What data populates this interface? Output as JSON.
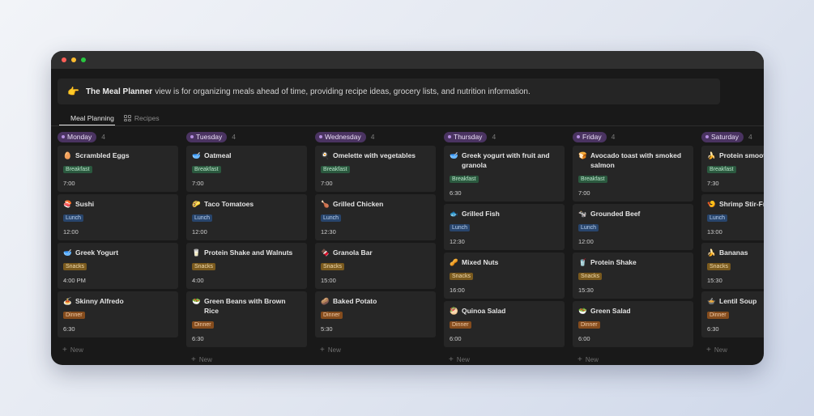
{
  "callout": {
    "emoji": "👉",
    "bold": "The Meal Planner",
    "text": "view is for organizing meals ahead of time, providing recipe ideas, grocery lists, and nutrition information."
  },
  "tabs": [
    {
      "label": "Meal Planning",
      "icon": "board-icon",
      "active": true
    },
    {
      "label": "Recipes",
      "icon": "gallery-icon",
      "active": false
    }
  ],
  "new_label": "New",
  "colors": {
    "Breakfast": "#2b593f",
    "Lunch": "#28456c",
    "Snacks": "#7a5a1e",
    "Dinner": "#854c1d",
    "day_pill": "#4a3361"
  },
  "columns": [
    {
      "day": "Monday",
      "count": "4",
      "cards": [
        {
          "emoji": "🥚",
          "title": "Scrambled Eggs",
          "tag": "Breakfast",
          "time": "7:00"
        },
        {
          "emoji": "🍣",
          "title": "Sushi",
          "tag": "Lunch",
          "time": "12:00"
        },
        {
          "emoji": "🥣",
          "title": "Greek Yogurt",
          "tag": "Snacks",
          "time": "4:00 PM"
        },
        {
          "emoji": "🍝",
          "title": "Skinny Alfredo",
          "tag": "Dinner",
          "time": "6:30"
        }
      ]
    },
    {
      "day": "Tuesday",
      "count": "4",
      "cards": [
        {
          "emoji": "🥣",
          "title": "Oatmeal",
          "tag": "Breakfast",
          "time": "7:00"
        },
        {
          "emoji": "🌮",
          "title": "Taco Tomatoes",
          "tag": "Lunch",
          "time": "12:00"
        },
        {
          "emoji": "🥛",
          "title": "Protein Shake and Walnuts",
          "tag": "Snacks",
          "time": "4:00"
        },
        {
          "emoji": "🥗",
          "title": "Green Beans with Brown Rice",
          "tag": "Dinner",
          "time": "6:30"
        }
      ]
    },
    {
      "day": "Wednesday",
      "count": "4",
      "cards": [
        {
          "emoji": "🍳",
          "title": "Omelette with vegetables",
          "tag": "Breakfast",
          "time": "7:00"
        },
        {
          "emoji": "🍗",
          "title": "Grilled Chicken",
          "tag": "Lunch",
          "time": "12:30"
        },
        {
          "emoji": "🍫",
          "title": "Granola Bar",
          "tag": "Snacks",
          "time": "15:00"
        },
        {
          "emoji": "🥔",
          "title": "Baked Potato",
          "tag": "Dinner",
          "time": "5:30"
        }
      ]
    },
    {
      "day": "Thursday",
      "count": "4",
      "cards": [
        {
          "emoji": "🥣",
          "title": "Greek yogurt with fruit and granola",
          "tag": "Breakfast",
          "time": "6:30"
        },
        {
          "emoji": "🐟",
          "title": "Grilled Fish",
          "tag": "Lunch",
          "time": "12:30"
        },
        {
          "emoji": "🥜",
          "title": "Mixed Nuts",
          "tag": "Snacks",
          "time": "16:00"
        },
        {
          "emoji": "🥙",
          "title": "Quinoa Salad",
          "tag": "Dinner",
          "time": "6:00"
        }
      ]
    },
    {
      "day": "Friday",
      "count": "4",
      "cards": [
        {
          "emoji": "🍞",
          "title": "Avocado toast with smoked salmon",
          "tag": "Breakfast",
          "time": "7:00"
        },
        {
          "emoji": "🐄",
          "title": "Grounded Beef",
          "tag": "Lunch",
          "time": "12:00"
        },
        {
          "emoji": "🥤",
          "title": "Protein Shake",
          "tag": "Snacks",
          "time": "15:30"
        },
        {
          "emoji": "🥗",
          "title": "Green Salad",
          "tag": "Dinner",
          "time": "6:00"
        }
      ]
    },
    {
      "day": "Saturday",
      "count": "4",
      "cards": [
        {
          "emoji": "🍌",
          "title": "Protein smoothie",
          "tag": "Breakfast",
          "time": "7:30"
        },
        {
          "emoji": "🍤",
          "title": "Shrimp Stir-Fry",
          "tag": "Lunch",
          "time": "13:00"
        },
        {
          "emoji": "🍌",
          "title": "Bananas",
          "tag": "Snacks",
          "time": "15:30"
        },
        {
          "emoji": "🍲",
          "title": "Lentil Soup",
          "tag": "Dinner",
          "time": "6:30"
        }
      ]
    }
  ]
}
